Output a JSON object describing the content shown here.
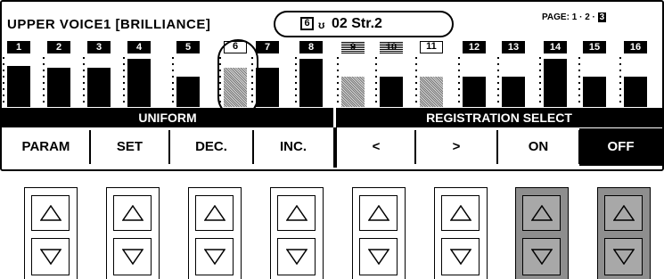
{
  "header": {
    "title": "UPPER VOICE1 [BRILLIANCE]",
    "title_tail": "[",
    "voice_position": "6",
    "voice_icon": "ʊ",
    "voice_name": "02 Str.2",
    "page_label": "PAGE:",
    "pages": [
      "1",
      "·",
      "2",
      "·",
      "3"
    ]
  },
  "channels": [
    {
      "num": "1",
      "level": 0.83,
      "style": "solid",
      "head": "filled"
    },
    {
      "num": "2",
      "level": 0.78,
      "style": "solid",
      "head": "filled"
    },
    {
      "num": "3",
      "level": 0.78,
      "style": "solid",
      "head": "filled"
    },
    {
      "num": "4",
      "level": 0.96,
      "style": "solid",
      "head": "filled"
    },
    {
      "num": "5",
      "level": 0.61,
      "style": "solid",
      "head": "filled"
    },
    {
      "num": "6",
      "level": 0.78,
      "style": "hatch",
      "head": "open"
    },
    {
      "num": "7",
      "level": 0.78,
      "style": "solid",
      "head": "filled"
    },
    {
      "num": "8",
      "level": 0.96,
      "style": "solid",
      "head": "filled"
    },
    {
      "num": "9",
      "level": 0.61,
      "style": "hatch",
      "head": "dim"
    },
    {
      "num": "10",
      "level": 0.61,
      "style": "solid",
      "head": "dim"
    },
    {
      "num": "11",
      "level": 0.61,
      "style": "hatch",
      "head": "open"
    },
    {
      "num": "12",
      "level": 0.61,
      "style": "solid",
      "head": "filled"
    },
    {
      "num": "13",
      "level": 0.61,
      "style": "solid",
      "head": "filled"
    },
    {
      "num": "14",
      "level": 0.96,
      "style": "solid",
      "head": "filled"
    },
    {
      "num": "15",
      "level": 0.61,
      "style": "solid",
      "head": "filled"
    },
    {
      "num": "16",
      "level": 0.61,
      "style": "solid",
      "head": "filled"
    }
  ],
  "function_bar": {
    "left_label": "UNIFORM",
    "right_label": "REGISTRATION SELECT"
  },
  "soft_buttons": [
    {
      "label": "PARAM",
      "active": false
    },
    {
      "label": "SET",
      "active": false
    },
    {
      "label": "DEC.",
      "active": false
    },
    {
      "label": "INC.",
      "active": false
    },
    {
      "label": "<",
      "active": false
    },
    {
      "label": ">",
      "active": false
    },
    {
      "label": "ON",
      "active": false
    },
    {
      "label": "OFF",
      "active": true
    }
  ],
  "hardware_buttons": [
    {
      "column": 1,
      "shade": "white"
    },
    {
      "column": 2,
      "shade": "white"
    },
    {
      "column": 3,
      "shade": "white"
    },
    {
      "column": 4,
      "shade": "white"
    },
    {
      "column": 5,
      "shade": "white"
    },
    {
      "column": 6,
      "shade": "white"
    },
    {
      "column": 7,
      "shade": "grey"
    },
    {
      "column": 8,
      "shade": "grey"
    }
  ],
  "colors": {
    "ink": "#000000",
    "panel": "#ffffff",
    "grey_button": "#8e8e8e"
  }
}
